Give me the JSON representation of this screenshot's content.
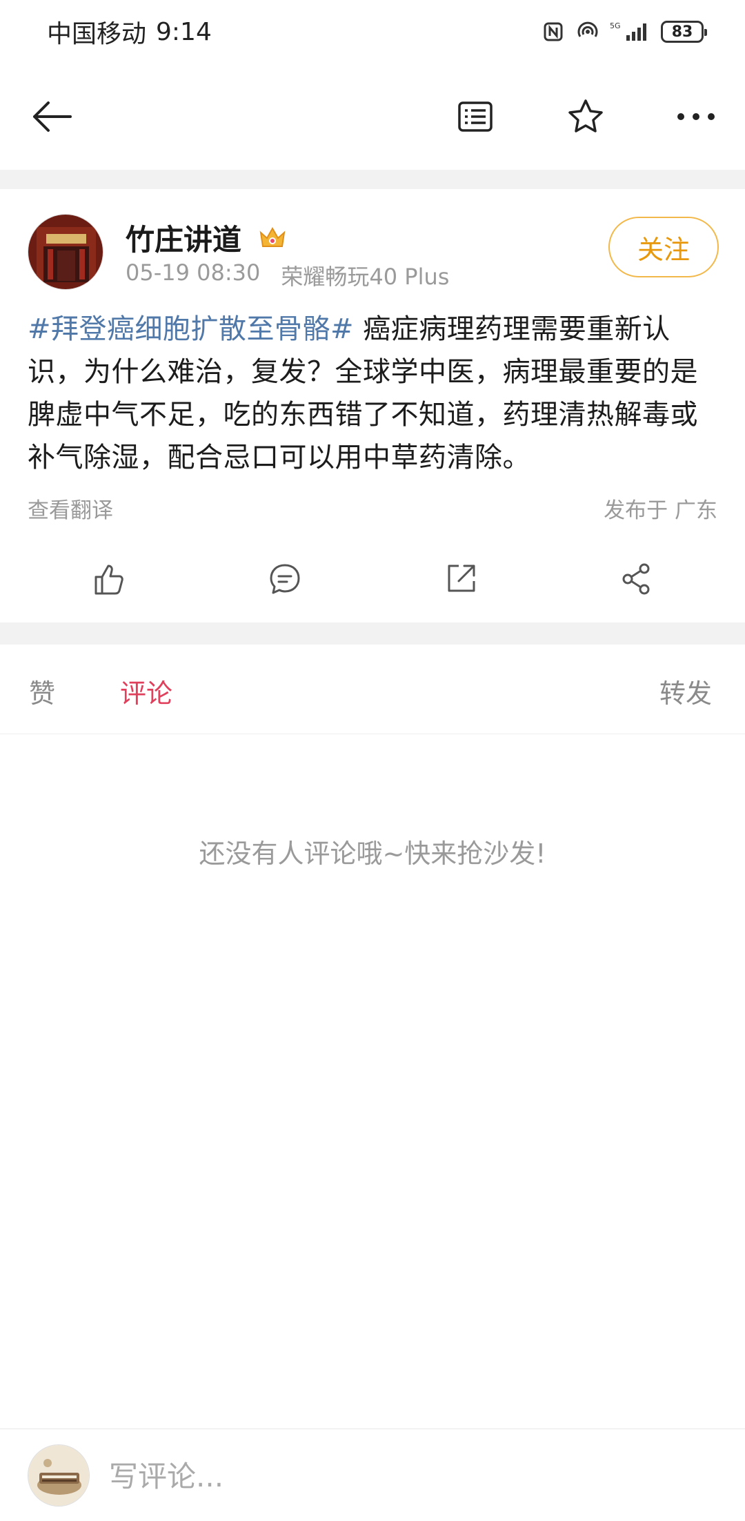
{
  "status_bar": {
    "carrier": "中国移动",
    "time": "9:14",
    "network": "5G",
    "battery": "83"
  },
  "nav": {
    "back_icon": "arrow-left-icon",
    "reader_icon": "article-list-icon",
    "star_icon": "star-icon",
    "more_icon": "more-dots-icon"
  },
  "post": {
    "author": "竹庄讲道",
    "badge_icon": "crown-badge-icon",
    "date": "05-19 08:30",
    "device": "荣耀畅玩40 Plus",
    "follow_label": "关注",
    "hashtag": "#拜登癌细胞扩散至骨骼#",
    "body": " 癌症病理药理需要重新认识，为什么难治，复发？全球学中医，病理最重要的是脾虚中气不足，吃的东西错了不知道，药理清热解毒或补气除湿，配合忌口可以用中草药清除。",
    "translate_label": "查看翻译",
    "location": "发布于 广东"
  },
  "actions": [
    "like-icon",
    "comment-icon",
    "repost-icon",
    "share-icon"
  ],
  "tabs": {
    "like": "赞",
    "comment": "评论",
    "repost": "转发",
    "active": "comment"
  },
  "empty_message": "还没有人评论哦~快来抢沙发!",
  "comment_bar": {
    "placeholder": "写评论..."
  },
  "colors": {
    "accent_red": "#e0405c",
    "follow_orange": "#e8980c",
    "hashtag_blue": "#5078a8"
  }
}
